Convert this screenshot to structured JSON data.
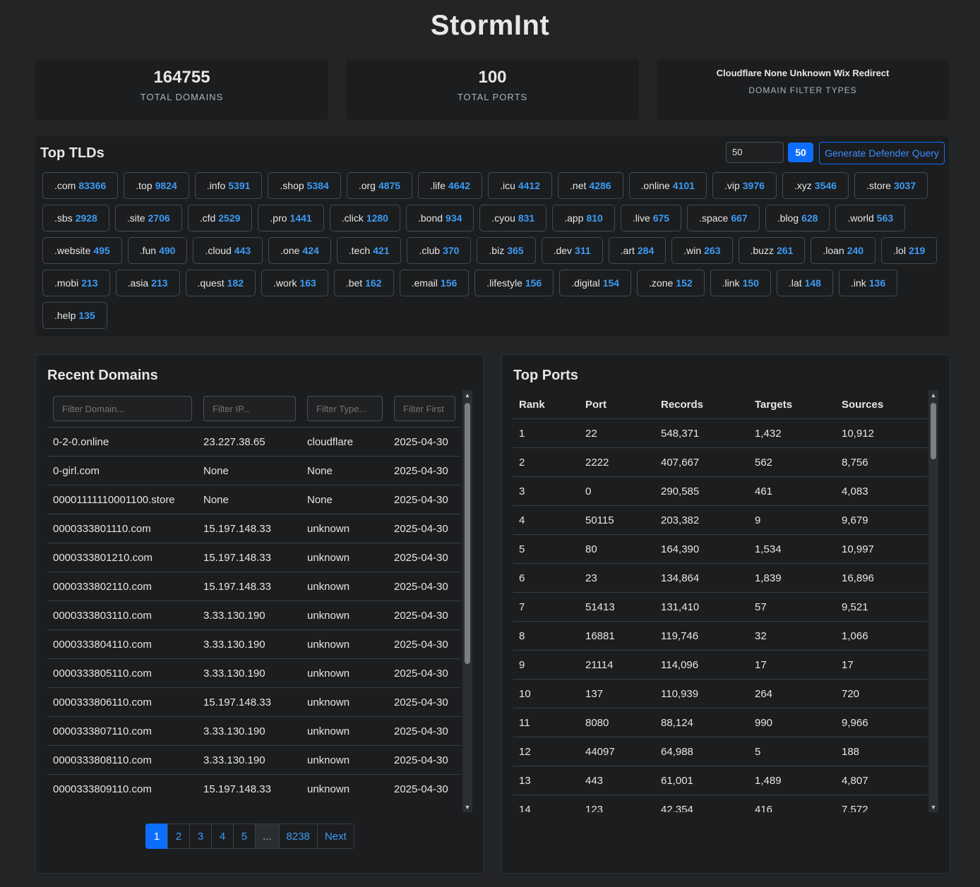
{
  "app": {
    "title": "StormInt"
  },
  "stats": {
    "domains": {
      "value": "164755",
      "label": "TOTAL DOMAINS"
    },
    "ports": {
      "value": "100",
      "label": "TOTAL PORTS"
    },
    "filters": {
      "value": "Cloudflare None Unknown Wix Redirect",
      "label": "DOMAIN FILTER TYPES"
    }
  },
  "tlds": {
    "heading": "Top TLDs",
    "count_input_value": "50",
    "count_badge": "50",
    "defender_button": "Generate Defender Query",
    "items": [
      {
        "name": ".com",
        "count": "83366"
      },
      {
        "name": ".top",
        "count": "9824"
      },
      {
        "name": ".info",
        "count": "5391"
      },
      {
        "name": ".shop",
        "count": "5384"
      },
      {
        "name": ".org",
        "count": "4875"
      },
      {
        "name": ".life",
        "count": "4642"
      },
      {
        "name": ".icu",
        "count": "4412"
      },
      {
        "name": ".net",
        "count": "4286"
      },
      {
        "name": ".online",
        "count": "4101"
      },
      {
        "name": ".vip",
        "count": "3976"
      },
      {
        "name": ".xyz",
        "count": "3546"
      },
      {
        "name": ".store",
        "count": "3037"
      },
      {
        "name": ".sbs",
        "count": "2928"
      },
      {
        "name": ".site",
        "count": "2706"
      },
      {
        "name": ".cfd",
        "count": "2529"
      },
      {
        "name": ".pro",
        "count": "1441"
      },
      {
        "name": ".click",
        "count": "1280"
      },
      {
        "name": ".bond",
        "count": "934"
      },
      {
        "name": ".cyou",
        "count": "831"
      },
      {
        "name": ".app",
        "count": "810"
      },
      {
        "name": ".live",
        "count": "675"
      },
      {
        "name": ".space",
        "count": "667"
      },
      {
        "name": ".blog",
        "count": "628"
      },
      {
        "name": ".world",
        "count": "563"
      },
      {
        "name": ".website",
        "count": "495"
      },
      {
        "name": ".fun",
        "count": "490"
      },
      {
        "name": ".cloud",
        "count": "443"
      },
      {
        "name": ".one",
        "count": "424"
      },
      {
        "name": ".tech",
        "count": "421"
      },
      {
        "name": ".club",
        "count": "370"
      },
      {
        "name": ".biz",
        "count": "365"
      },
      {
        "name": ".dev",
        "count": "311"
      },
      {
        "name": ".art",
        "count": "284"
      },
      {
        "name": ".win",
        "count": "263"
      },
      {
        "name": ".buzz",
        "count": "261"
      },
      {
        "name": ".loan",
        "count": "240"
      },
      {
        "name": ".lol",
        "count": "219"
      },
      {
        "name": ".mobi",
        "count": "213"
      },
      {
        "name": ".asia",
        "count": "213"
      },
      {
        "name": ".quest",
        "count": "182"
      },
      {
        "name": ".work",
        "count": "163"
      },
      {
        "name": ".bet",
        "count": "162"
      },
      {
        "name": ".email",
        "count": "156"
      },
      {
        "name": ".lifestyle",
        "count": "156"
      },
      {
        "name": ".digital",
        "count": "154"
      },
      {
        "name": ".zone",
        "count": "152"
      },
      {
        "name": ".link",
        "count": "150"
      },
      {
        "name": ".lat",
        "count": "148"
      },
      {
        "name": ".ink",
        "count": "136"
      },
      {
        "name": ".help",
        "count": "135"
      }
    ]
  },
  "recent": {
    "title": "Recent Domains",
    "filters": {
      "domain_placeholder": "Filter Domain...",
      "ip_placeholder": "Filter IP...",
      "type_placeholder": "Filter Type...",
      "first_placeholder": "Filter First"
    },
    "rows": [
      [
        "0-2-0.online",
        "23.227.38.65",
        "cloudflare",
        "2025-04-30"
      ],
      [
        "0-girl.com",
        "None",
        "None",
        "2025-04-30"
      ],
      [
        "00001111110001100.store",
        "None",
        "None",
        "2025-04-30"
      ],
      [
        "0000333801110.com",
        "15.197.148.33",
        "unknown",
        "2025-04-30"
      ],
      [
        "0000333801210.com",
        "15.197.148.33",
        "unknown",
        "2025-04-30"
      ],
      [
        "0000333802110.com",
        "15.197.148.33",
        "unknown",
        "2025-04-30"
      ],
      [
        "0000333803110.com",
        "3.33.130.190",
        "unknown",
        "2025-04-30"
      ],
      [
        "0000333804110.com",
        "3.33.130.190",
        "unknown",
        "2025-04-30"
      ],
      [
        "0000333805110.com",
        "3.33.130.190",
        "unknown",
        "2025-04-30"
      ],
      [
        "0000333806110.com",
        "15.197.148.33",
        "unknown",
        "2025-04-30"
      ],
      [
        "0000333807110.com",
        "3.33.130.190",
        "unknown",
        "2025-04-30"
      ],
      [
        "0000333808110.com",
        "3.33.130.190",
        "unknown",
        "2025-04-30"
      ],
      [
        "0000333809110.com",
        "15.197.148.33",
        "unknown",
        "2025-04-30"
      ]
    ],
    "pagination": {
      "pages": [
        "1",
        "2",
        "3",
        "4",
        "5"
      ],
      "ellipsis": "...",
      "last": "8238",
      "next": "Next"
    }
  },
  "ports": {
    "title": "Top Ports",
    "columns": [
      "Rank",
      "Port",
      "Records",
      "Targets",
      "Sources"
    ],
    "rows": [
      [
        "1",
        "22",
        "548,371",
        "1,432",
        "10,912"
      ],
      [
        "2",
        "2222",
        "407,667",
        "562",
        "8,756"
      ],
      [
        "3",
        "0",
        "290,585",
        "461",
        "4,083"
      ],
      [
        "4",
        "50115",
        "203,382",
        "9",
        "9,679"
      ],
      [
        "5",
        "80",
        "164,390",
        "1,534",
        "10,997"
      ],
      [
        "6",
        "23",
        "134,864",
        "1,839",
        "16,896"
      ],
      [
        "7",
        "51413",
        "131,410",
        "57",
        "9,521"
      ],
      [
        "8",
        "16881",
        "119,746",
        "32",
        "1,066"
      ],
      [
        "9",
        "21114",
        "114,096",
        "17",
        "17"
      ],
      [
        "10",
        "137",
        "110,939",
        "264",
        "720"
      ],
      [
        "11",
        "8080",
        "88,124",
        "990",
        "9,966"
      ],
      [
        "12",
        "44097",
        "64,988",
        "5",
        "188"
      ],
      [
        "13",
        "443",
        "61,001",
        "1,489",
        "4,807"
      ],
      [
        "14",
        "123",
        "42,354",
        "416",
        "7,572"
      ]
    ]
  }
}
